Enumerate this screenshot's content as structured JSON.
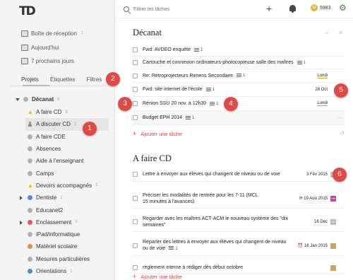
{
  "app": {
    "logo": "TD"
  },
  "sidebar": {
    "filters": [
      {
        "label": "Boîte de réception",
        "count": "1",
        "icon": "inbox-icon"
      },
      {
        "label": "Aujourd'hui",
        "count": "",
        "icon": "calendar-today-icon"
      },
      {
        "label": "7 prochains jours",
        "count": "",
        "icon": "calendar-week-icon"
      }
    ],
    "tabs": [
      "Projets",
      "Étiquettes",
      "Filtres"
    ],
    "parent_project": {
      "label": "Décanat",
      "count": "6",
      "color": "#b0b0b0"
    },
    "projects": [
      {
        "label": "A faire CD",
        "count": "5",
        "kind": "star",
        "color": "#e6b800"
      },
      {
        "label": "A discuter CD",
        "count": "1",
        "kind": "person",
        "color": "#888888"
      },
      {
        "label": "A faire CDE",
        "count": "",
        "kind": "dot",
        "color": "#b0b0b0"
      },
      {
        "label": "Absences",
        "count": "",
        "kind": "dot",
        "color": "#b0b0b0"
      },
      {
        "label": "Aide à l'enseignant",
        "count": "",
        "kind": "dot",
        "color": "#b0b0b0"
      },
      {
        "label": "Camps",
        "count": "",
        "kind": "dot",
        "color": "#b0b0b0"
      },
      {
        "label": "Devoirs accompagnés",
        "count": "3",
        "kind": "star",
        "color": "#e6b800"
      },
      {
        "label": "Dentiste",
        "count": "1",
        "kind": "dot",
        "color": "#4a90d9",
        "collapsed": true
      },
      {
        "label": "Educanet2",
        "count": "",
        "kind": "dot",
        "color": "#b0b0b0"
      },
      {
        "label": "Enclassement",
        "count": "3",
        "kind": "dot",
        "color": "#e8584f",
        "collapsed": true
      },
      {
        "label": "iPad/informatique",
        "count": "",
        "kind": "dot",
        "color": "#b0b0b0"
      },
      {
        "label": "Matériel scolaire",
        "count": "",
        "kind": "dot",
        "color": "#f0874a"
      },
      {
        "label": "Mesures particulières",
        "count": "",
        "kind": "dot",
        "color": "#b0b0b0"
      },
      {
        "label": "Orientations",
        "count": "1",
        "kind": "dot",
        "color": "#4a90d9"
      }
    ]
  },
  "topbar": {
    "search_placeholder": "Filtrer les tâches",
    "karma": "5983",
    "karma_badge": "U"
  },
  "main": {
    "sections": [
      {
        "title": "Décanat",
        "tasks": [
          {
            "name": "Fwd: AVDEO enquête",
            "notes": "1",
            "date": "",
            "lundi": false
          },
          {
            "name": "Cartouche et connexion ordinateurs-photocopieuse salle des maîtres",
            "notes": "1",
            "date": "",
            "lundi": false
          },
          {
            "name": "Re: Rétroprojecteurs Renens Secondaire",
            "notes": "1",
            "date": "Lundi",
            "lundi": true
          },
          {
            "name": "Fwd: site internet de l'école",
            "notes": "1",
            "date": "28 Oct",
            "lundi": false
          },
          {
            "name": "Rénion SSU 20 nov. à 12h30",
            "notes": "1",
            "date": "Lundi",
            "lundi": true
          },
          {
            "name": "Budget EPH 2014",
            "notes": "1",
            "date": "",
            "lundi": false
          }
        ],
        "add_label": "Ajouter une tâche"
      },
      {
        "title": "A faire CD",
        "tasks": [
          {
            "name": "Lettre à envoyer aux élèves qui changent de niveau ou de voie",
            "notes": "",
            "date": "3 Fév 2015",
            "tag": "MJ",
            "tag_color": "#b8b8b8"
          },
          {
            "name": "Préciser les modalités de rentrée pour les 7-11 (MCL 15 minutes à l'avances)",
            "notes": "",
            "date": "19 Aou 2015",
            "tag": "HM",
            "tag_color": "#b0479e"
          },
          {
            "name": "Regarder avec les maîtres ACT-ACM le nouveau système des \"dix semaines\"",
            "notes": "",
            "date": "16 Déc",
            "tag": "MJ",
            "tag_color": "#b8b8b8"
          },
          {
            "name": "Reparler des lettres à envoyer aux élèves qui changent de niveau ou de voie",
            "notes": "1",
            "date": "16 Jan 2015",
            "tag": "",
            "tag_color": "#c9a46a"
          },
          {
            "name": "règlement interne à rédiger dès début octobre",
            "notes": "",
            "date": "",
            "tag": "",
            "tag_color": "#c9a46a"
          }
        ],
        "add_label": "Ajouter une tâche"
      }
    ]
  },
  "markers": [
    "1",
    "2",
    "3",
    "4",
    "5",
    "6"
  ],
  "colors": {
    "accent": "#e14a44",
    "add_task": "#dd4444",
    "lundi_underline": "#e8a800"
  }
}
